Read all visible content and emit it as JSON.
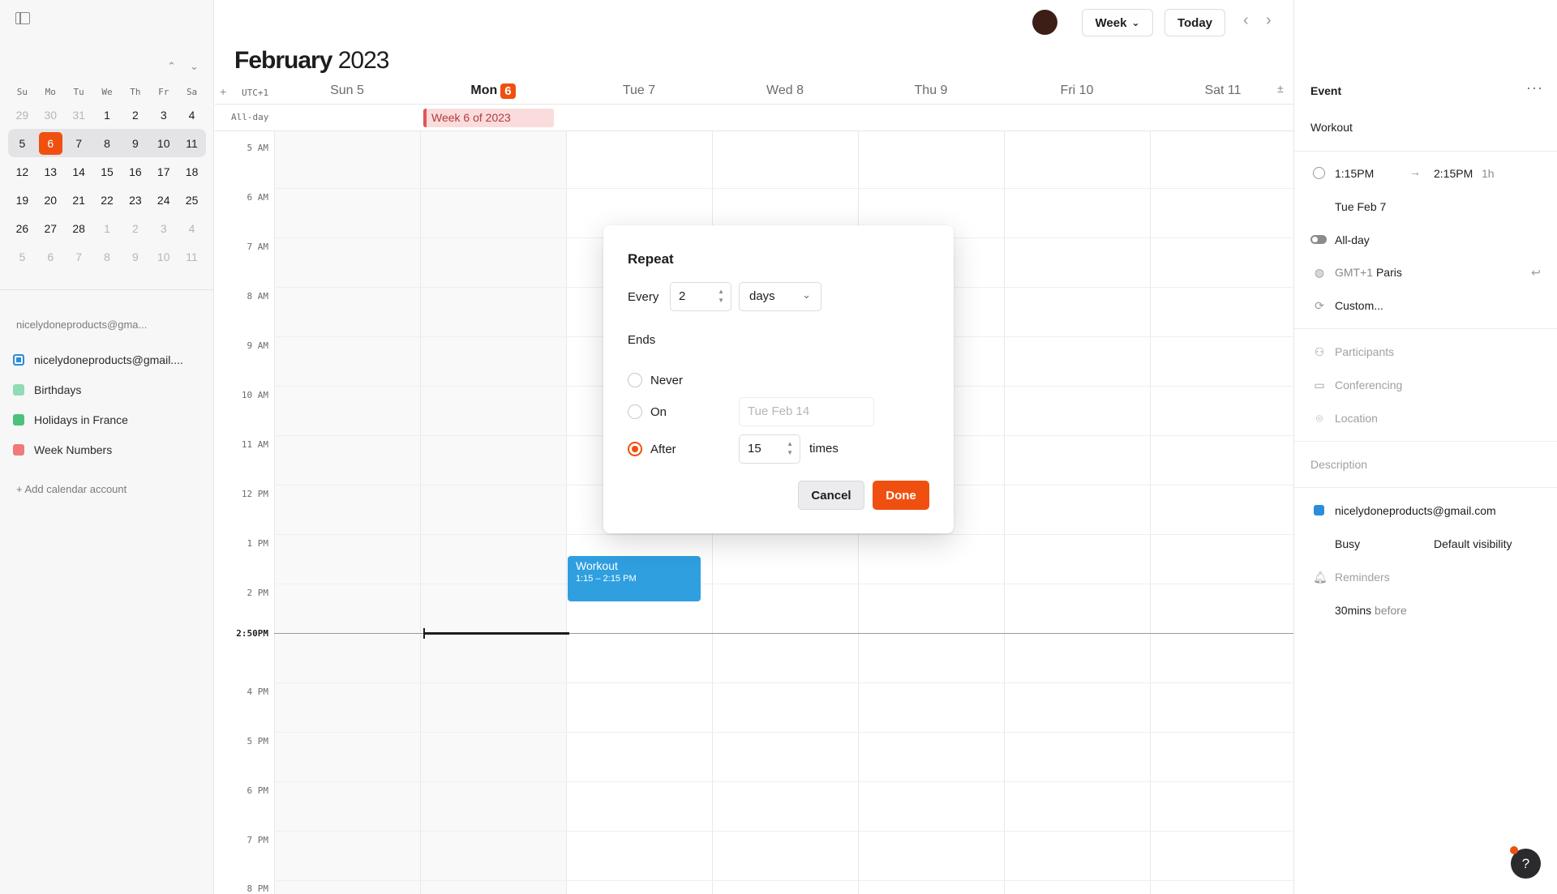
{
  "sidebar": {
    "mini_calendar": {
      "weekdays": [
        "Su",
        "Mo",
        "Tu",
        "We",
        "Th",
        "Fr",
        "Sa"
      ],
      "weeks": [
        [
          "29",
          "30",
          "31",
          "1",
          "2",
          "3",
          "4"
        ],
        [
          "5",
          "6",
          "7",
          "8",
          "9",
          "10",
          "11"
        ],
        [
          "12",
          "13",
          "14",
          "15",
          "16",
          "17",
          "18"
        ],
        [
          "19",
          "20",
          "21",
          "22",
          "23",
          "24",
          "25"
        ],
        [
          "26",
          "27",
          "28",
          "1",
          "2",
          "3",
          "4"
        ],
        [
          "5",
          "6",
          "7",
          "8",
          "9",
          "10",
          "11"
        ]
      ]
    },
    "account_header": "nicelydoneproducts@gma...",
    "calendars": [
      {
        "label": "nicelydoneproducts@gmail...."
      },
      {
        "label": "Birthdays"
      },
      {
        "label": "Holidays in France"
      },
      {
        "label": "Week Numbers"
      }
    ],
    "add_account": "Add calendar account"
  },
  "toolbar": {
    "view_label": "Week",
    "today_label": "Today"
  },
  "header": {
    "month": "February",
    "year": "2023",
    "timezone": "UTC+1",
    "days": [
      {
        "label": "Sun 5"
      },
      {
        "label": "Mon",
        "badge": "6"
      },
      {
        "label": "Tue 7"
      },
      {
        "label": "Wed 8"
      },
      {
        "label": "Thu 9"
      },
      {
        "label": "Fri 10"
      },
      {
        "label": "Sat 11"
      }
    ]
  },
  "allday": {
    "label": "All-day",
    "week_chip": "Week 6 of 2023"
  },
  "hours": [
    "5 AM",
    "6 AM",
    "7 AM",
    "8 AM",
    "9 AM",
    "10 AM",
    "11 AM",
    "12 PM",
    "1 PM",
    "2 PM",
    "4 PM",
    "5 PM",
    "6 PM",
    "7 PM",
    "8 PM"
  ],
  "now_label": "2:50PM",
  "event": {
    "title": "Workout",
    "time": "1:15 – 2:15 PM"
  },
  "repeat_modal": {
    "title": "Repeat",
    "every_label": "Every",
    "every_value": "2",
    "unit": "days",
    "ends_label": "Ends",
    "never_label": "Never",
    "on_label": "On",
    "on_placeholder": "Tue Feb 14",
    "after_label": "After",
    "after_value": "15",
    "times_label": "times",
    "cancel": "Cancel",
    "done": "Done"
  },
  "right_panel": {
    "header": "Event",
    "event_name": "Workout",
    "start": "1:15PM",
    "end": "2:15PM",
    "duration": "1h",
    "date": "Tue Feb 7",
    "allday": "All-day",
    "tz_offset": "GMT+1",
    "tz_city": "Paris",
    "repeat": "Custom...",
    "participants": "Participants",
    "conferencing": "Conferencing",
    "location": "Location",
    "description": "Description",
    "calendar": "nicelydoneproducts@gmail.com",
    "busy": "Busy",
    "visibility": "Default visibility",
    "reminders": "Reminders",
    "reminder_value": "30mins",
    "reminder_suffix": "before"
  },
  "colors": {
    "accent": "#f0500f",
    "event_blue": "#2f9fe0"
  }
}
